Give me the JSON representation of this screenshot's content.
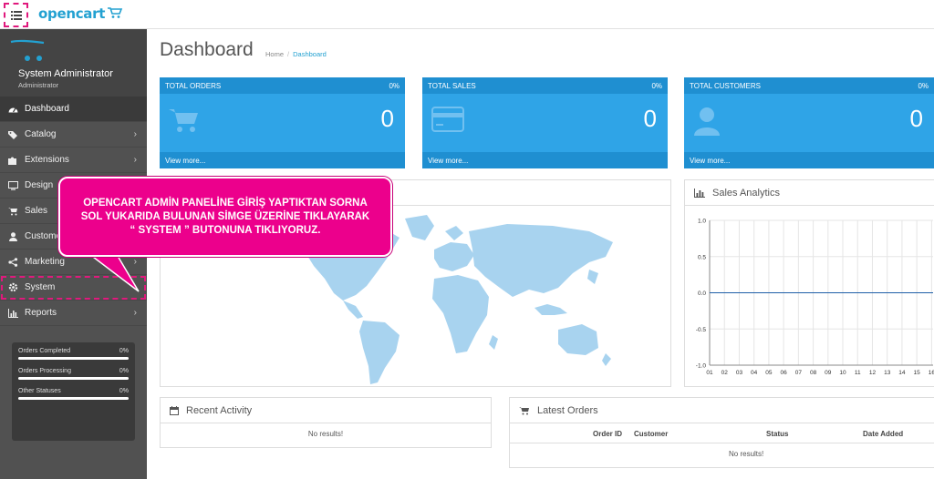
{
  "header": {
    "logo_text": "opencart"
  },
  "profile": {
    "name": "System Administrator",
    "role": "Administrator"
  },
  "nav": {
    "dashboard": "Dashboard",
    "catalog": "Catalog",
    "extensions": "Extensions",
    "design": "Design",
    "sales": "Sales",
    "customers": "Customers",
    "marketing": "Marketing",
    "system": "System",
    "reports": "Reports"
  },
  "sidebar_stats": [
    {
      "label": "Orders Completed",
      "value": "0%"
    },
    {
      "label": "Orders Processing",
      "value": "0%"
    },
    {
      "label": "Other Statuses",
      "value": "0%"
    }
  ],
  "page": {
    "title": "Dashboard",
    "breadcrumb_home": "Home",
    "breadcrumb_current": "Dashboard"
  },
  "tiles": [
    {
      "title": "TOTAL ORDERS",
      "pct": "0%",
      "value": "0",
      "link": "View more..."
    },
    {
      "title": "TOTAL SALES",
      "pct": "0%",
      "value": "0",
      "link": "View more..."
    },
    {
      "title": "TOTAL CUSTOMERS",
      "pct": "0%",
      "value": "0",
      "link": "View more..."
    }
  ],
  "sales_analytics": {
    "title": "Sales Analytics",
    "chart_data": {
      "type": "line",
      "x": [
        "01",
        "02",
        "03",
        "04",
        "05",
        "06",
        "07",
        "08",
        "09",
        "10",
        "11",
        "12",
        "13",
        "14",
        "15",
        "16"
      ],
      "series": [
        {
          "values": [
            0,
            0,
            0,
            0,
            0,
            0,
            0,
            0,
            0,
            0,
            0,
            0,
            0,
            0,
            0,
            0
          ]
        }
      ],
      "y_ticks": [
        "1.0",
        "0.5",
        "0.0",
        "-0.5",
        "-1.0"
      ],
      "ylim": [
        -1,
        1
      ],
      "grid": true,
      "color": "#1f5fa8"
    }
  },
  "recent_activity": {
    "title": "Recent Activity",
    "empty": "No results!"
  },
  "latest_orders": {
    "title": "Latest Orders",
    "columns": [
      "Order ID",
      "Customer",
      "Status",
      "Date Added"
    ],
    "empty": "No results!"
  },
  "callout": {
    "line1": "OPENCART ADMİN PANELİNE GİRİŞ YAPTIKTAN SORNA",
    "line2": "SOL YUKARIDA BULUNAN SİMGE ÜZERİNE TIKLAYARAK",
    "line3": "“ SYSTEM ” BUTONUNA TIKLIYORUZ."
  },
  "colors": {
    "accent": "#2fa4e7",
    "accent_dark": "#1f8fd1",
    "sidebar": "#515151",
    "callout": "#ec008c",
    "map": "#a8d3ef"
  }
}
